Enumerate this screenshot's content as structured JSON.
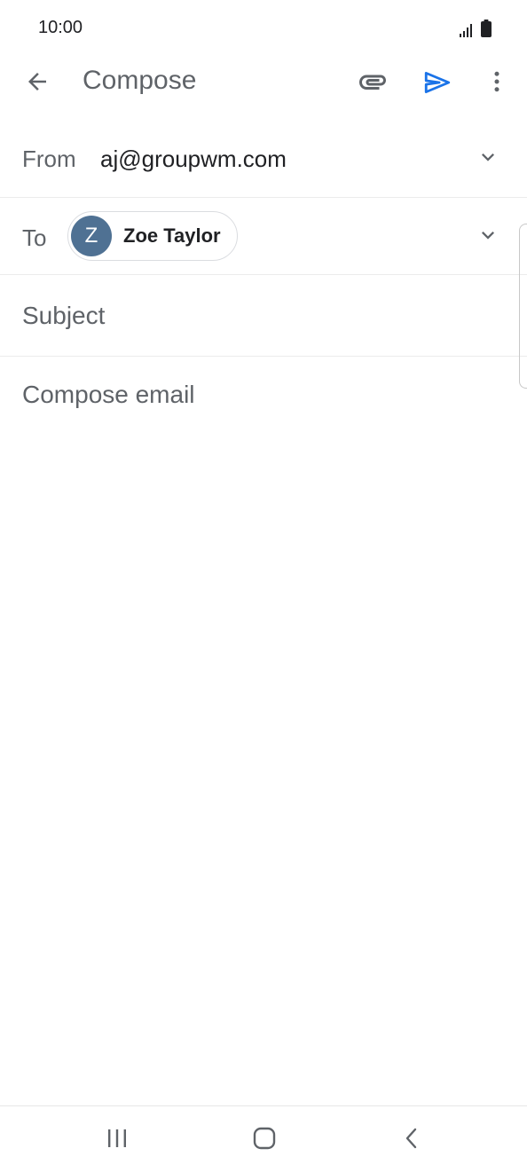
{
  "status_bar": {
    "time": "10:00",
    "icons": [
      "signal-icon",
      "battery-icon"
    ]
  },
  "app_bar": {
    "title": "Compose",
    "icons": [
      "back-arrow-icon",
      "attach-icon",
      "send-icon",
      "more-vert-icon"
    ],
    "accent_color": "#1a73e8"
  },
  "from": {
    "label": "From",
    "value": "aj@groupwm.com"
  },
  "to": {
    "label": "To",
    "recipient": {
      "initial": "Z",
      "name": "Zoe Taylor",
      "avatar_color": "#4f7193"
    }
  },
  "subject": {
    "placeholder": "Subject",
    "value": ""
  },
  "body": {
    "placeholder": "Compose email",
    "value": ""
  },
  "nav_bar": {
    "icons": [
      "recent-apps-icon",
      "home-icon",
      "nav-back-icon"
    ]
  }
}
